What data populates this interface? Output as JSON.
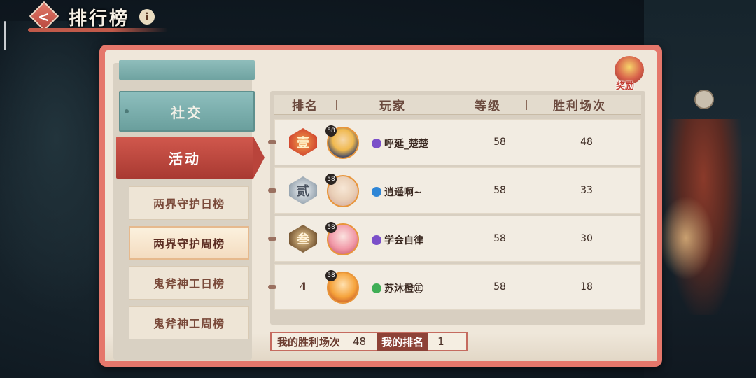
{
  "header": {
    "title": "排行榜",
    "info_label": "i"
  },
  "sidebar": {
    "categories": [
      {
        "label": ""
      },
      {
        "label": "社交"
      },
      {
        "label": "活动"
      }
    ],
    "sub_items": [
      {
        "label": "两界守护日榜"
      },
      {
        "label": "两界守护周榜"
      },
      {
        "label": "鬼斧神工日榜"
      },
      {
        "label": "鬼斧神工周榜"
      }
    ],
    "active_category": "活动",
    "active_sub_item": "两界守护周榜"
  },
  "reward": {
    "label": "奖励"
  },
  "table": {
    "headers": [
      "排名",
      "玩家",
      "等级",
      "胜利场次"
    ],
    "rows": [
      {
        "rank": "1",
        "rank_badge_text": "壹",
        "avatar_level": "58",
        "player": "呼延_楚楚",
        "level": "58",
        "wins": "48",
        "tag_color": "#7b4fc9"
      },
      {
        "rank": "2",
        "rank_badge_text": "贰",
        "avatar_level": "58",
        "player": "逍遥啊~",
        "level": "58",
        "wins": "33",
        "tag_color": "#2f86d6"
      },
      {
        "rank": "3",
        "rank_badge_text": "叁",
        "avatar_level": "58",
        "player": "学会自律",
        "level": "58",
        "wins": "30",
        "tag_color": "#7b4fc9"
      },
      {
        "rank": "4",
        "rank_badge_text": "",
        "avatar_level": "58",
        "player": "苏沐橙㊣",
        "level": "58",
        "wins": "18",
        "tag_color": "#3fae55"
      }
    ]
  },
  "footer": {
    "my_wins_label": "我的胜利场次",
    "my_wins_value": "48",
    "my_rank_label": "我的排名",
    "my_rank_value": "1"
  }
}
